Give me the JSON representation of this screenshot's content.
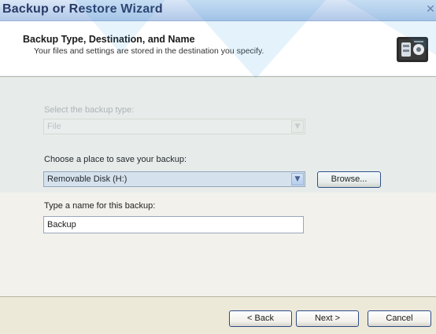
{
  "window": {
    "title": "Backup or Restore Wizard",
    "close_glyph": "✕"
  },
  "header": {
    "title": "Backup Type, Destination, and Name",
    "subtitle": "Your files and settings are stored in the destination you specify.",
    "icon": "backup-wizard-icon"
  },
  "form": {
    "backup_type": {
      "label": "Select the backup type:",
      "value": "File",
      "enabled": false
    },
    "destination": {
      "label": "Choose a place to save your backup:",
      "value": "Removable Disk (H:)",
      "browse_label": "Browse..."
    },
    "name": {
      "label": "Type a name for this backup:",
      "value": "Backup"
    }
  },
  "footer": {
    "back_label": "< Back",
    "next_label": "Next >",
    "cancel_label": "Cancel"
  },
  "colors": {
    "watermark": "#3fa6e0",
    "title_text": "#283a66",
    "button_border": "#2e4b85"
  }
}
